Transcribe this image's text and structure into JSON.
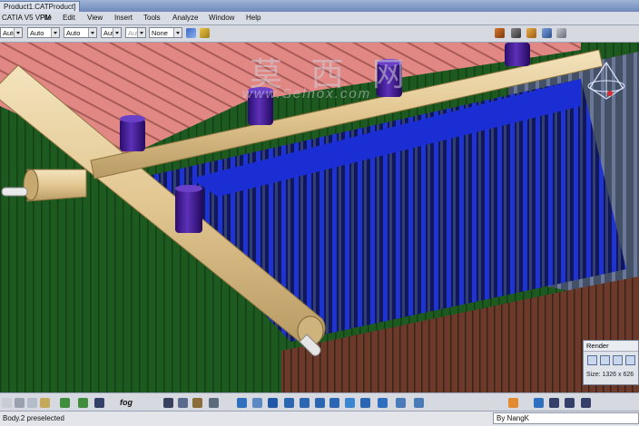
{
  "window": {
    "title": "Product1.CATProduct]"
  },
  "menu": [
    "CATIA V5 VPM",
    "File",
    "Edit",
    "View",
    "Insert",
    "Tools",
    "Analyze",
    "Window",
    "Help"
  ],
  "toolbar": {
    "combos": [
      "Auto",
      "Auto",
      "Auto",
      "Aut",
      "Aut",
      "None"
    ],
    "icons": [
      "paint-brush-icon",
      "format-painter-icon",
      "catalog-icon",
      "scissors-icon",
      "assembly-icon",
      "constraint-icon",
      "options-icon"
    ]
  },
  "watermark": {
    "main": "莫 西 网",
    "sub": "www.Selnox.com"
  },
  "render_panel": {
    "title": "Render",
    "size": "Size: 1326 x 626"
  },
  "bottom_toolbar": {
    "labels": [
      "fog"
    ],
    "icons": [
      "select-icon",
      "cut-icon",
      "copy-icon",
      "paste-icon",
      "undo-icon",
      "redo-icon",
      "help-icon",
      "fog-icon",
      "table-icon",
      "tree-icon",
      "tools-icon",
      "fly-icon",
      "fit-all-icon",
      "pan-icon",
      "rotate-icon",
      "zoom-in-icon",
      "zoom-out-icon",
      "normal-view-icon",
      "iso-view-icon",
      "view-mode-icon",
      "hide-show-icon",
      "swap-icon",
      "capture-icon",
      "render-icon",
      "compass-icon",
      "previous-icon",
      "first-icon",
      "next-icon",
      "last-icon"
    ]
  },
  "status": {
    "message": "Body.2 preselected",
    "credit": "By NangK"
  },
  "scene": {
    "roof_color": "#e38a86",
    "header_color": "#e6cc9a",
    "tube_color": "#1a30d0",
    "wall_color": "#1d5d1f",
    "cap_color": "#3a1a8e"
  }
}
